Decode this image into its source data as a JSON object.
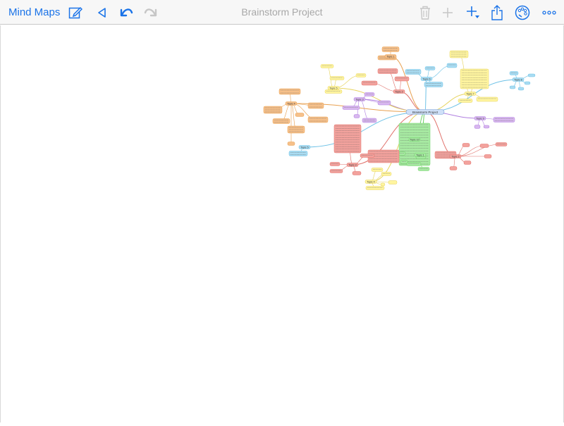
{
  "toolbar": {
    "back_label": "Mind Maps",
    "title": "Brainstorm Project",
    "accent_color": "#1a73e8",
    "disabled_color": "#c6c6c6",
    "icons": [
      "edit-icon",
      "triangle-left-icon",
      "undo-icon",
      "redo-icon",
      "trash-icon",
      "plus-icon",
      "add-child-icon",
      "share-icon",
      "palette-icon",
      "more-icon"
    ]
  },
  "mindmap": {
    "center_label": "Brainstorm Project",
    "colors": {
      "orange": "#f6c08a",
      "yellow": "#fff5a0",
      "blue": "#a9dcf2",
      "green": "#a7eaa2",
      "purple": "#d8b7ef",
      "red": "#f3a29d"
    },
    "topic_labels": [
      "Topic 1",
      "Topic 2",
      "Topic 3",
      "Topic 4",
      "Topic 5",
      "Topic 6",
      "Topic 7",
      "Topic 8",
      "Topic 9",
      "Topic 10"
    ]
  }
}
